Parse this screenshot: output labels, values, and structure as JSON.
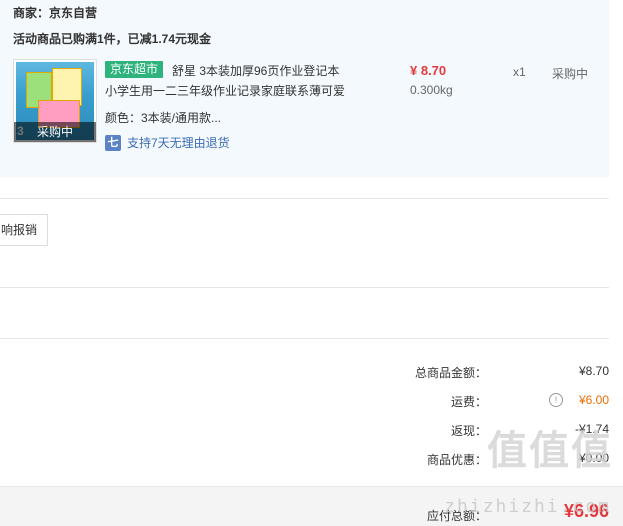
{
  "order": {
    "merchant": "商家：京东自营",
    "promo": "活动商品已购满1件，已减1.74元现金"
  },
  "item": {
    "thumb_overlay": "采购中",
    "thumb_number": "3",
    "tag": "京东超市",
    "title_line1": "舒星 3本装加厚96页作业登记本",
    "title_line2": "小学生用一二三年级作业记录家庭联系薄可爱",
    "spec": "颜色：3本装/通用款...",
    "return_policy": "支持7天无理由退货",
    "return_icon": "七",
    "price": "¥ 8.70",
    "weight": "0.300kg",
    "quantity": "x1",
    "status": "采购中"
  },
  "invoice": {
    "button_label": "响报销"
  },
  "summary": {
    "rows": [
      {
        "label": "总商品金额：",
        "value": "¥8.70"
      },
      {
        "label": "运费：",
        "value": "¥6.00"
      },
      {
        "label": "返现：",
        "value": "-¥1.74"
      },
      {
        "label": "商品优惠：",
        "value": "¥0.00"
      }
    ],
    "payable_label": "应付总额：",
    "payable_value": "¥6.96"
  },
  "watermark": {
    "main": "值值值",
    "sub": "zhizhizhi.com"
  },
  "colors": {
    "accent_red": "#e4393c",
    "freight_orange": "#ef6c00",
    "tag_green": "#2db37b",
    "link_blue": "#3c6bb5",
    "panel_bg": "#f3f9fd"
  }
}
